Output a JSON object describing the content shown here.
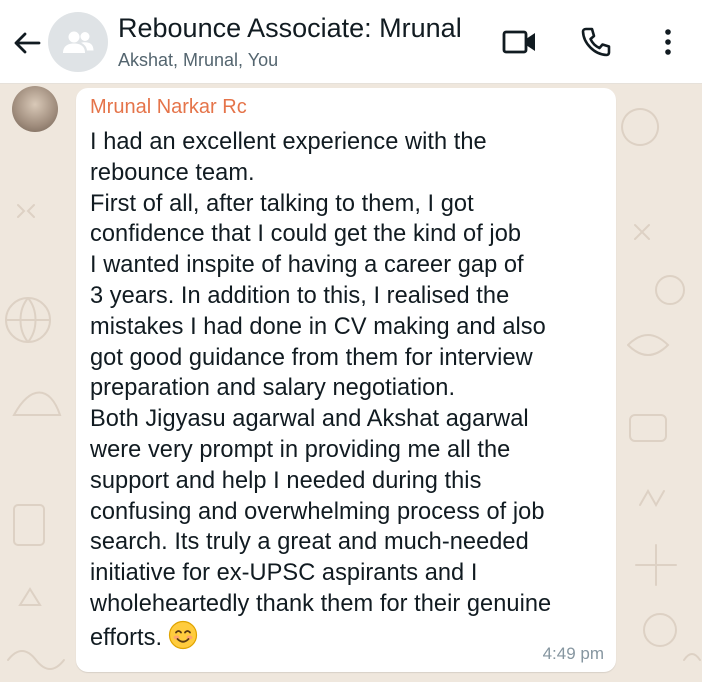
{
  "header": {
    "title": "Rebounce Associate: Mrunal",
    "subtitle": "Akshat, Mrunal, You",
    "icons": {
      "back": "arrow-left-icon",
      "group_avatar": "group-people-icon",
      "video": "video-camera-icon",
      "call": "phone-icon",
      "menu": "more-vertical-icon"
    }
  },
  "message": {
    "sender": "Mrunal Narkar Rc",
    "lines": [
      "I had an excellent experience with the",
      "rebounce team.",
      "First of all, after talking to them, I got",
      "confidence that I could get the kind of job",
      "I wanted inspite of having a career gap of",
      "3 years. In addition to this, I realised the",
      "mistakes I had done in CV making and also",
      "got good guidance from them for interview",
      "preparation and salary negotiation.",
      "Both Jigyasu agarwal and Akshat agarwal",
      "were very prompt in providing me all the",
      "support and help I needed during this",
      "confusing and overwhelming process of job",
      "search. Its truly a great and much-needed",
      "initiative for ex-UPSC aspirants and I",
      "wholeheartedly thank them for their genuine",
      "efforts."
    ],
    "emoji": "smiling-face-icon",
    "time": "4:49 pm"
  },
  "colors": {
    "sender_name": "#e5744a",
    "wallpaper": "#efe7dd",
    "bubble": "#ffffff",
    "header": "#ffffff"
  }
}
